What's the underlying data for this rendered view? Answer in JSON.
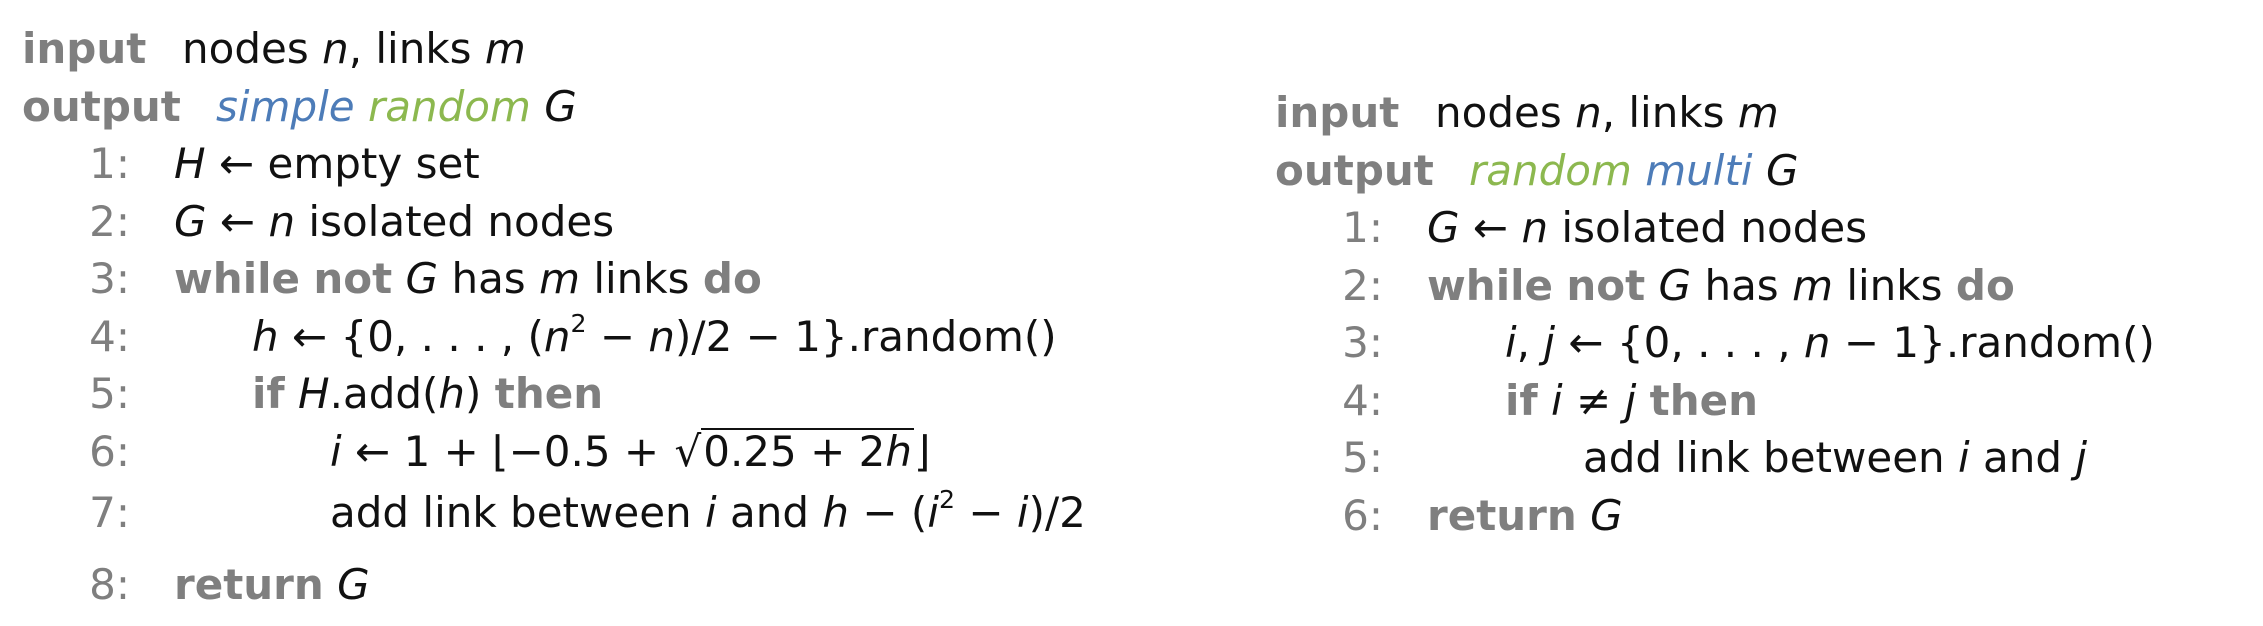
{
  "left": {
    "input_kw": "input",
    "input_text": "nodes",
    "input_n": "n",
    "input_links": ", links",
    "input_m": "m",
    "output_kw": "output",
    "output_simple": "simple",
    "output_random": "random",
    "output_G": "G",
    "lines": [
      {
        "no": "1:"
      },
      {
        "no": "2:"
      },
      {
        "no": "3:"
      },
      {
        "no": "4:"
      },
      {
        "no": "5:"
      },
      {
        "no": "6:"
      },
      {
        "no": "7:"
      },
      {
        "no": "8:"
      }
    ],
    "l1": {
      "H": "H",
      "arrow": " ← ",
      "rest": "empty set"
    },
    "l2": {
      "G": "G",
      "arrow": " ← ",
      "n": "n",
      "rest": " isolated nodes"
    },
    "l3": {
      "while": "while",
      "not": "not",
      "G": "G",
      "has": "has",
      "m": "m",
      "links": "links",
      "do": "do"
    },
    "l4": {
      "h": "h",
      "arrow": " ← {0, . . . , (",
      "n": "n",
      "sq": "2",
      "minus": " − ",
      "n2": "n",
      "tail": ")/2 − 1}.random()"
    },
    "l5": {
      "if": "if",
      "H": "H",
      "add": ".add(",
      "h": "h",
      "close": ")",
      "then": "then"
    },
    "l6": {
      "i": "i",
      "arrow": " ← 1 + ⌊−0.5 + ",
      "sqrt_sym": "√",
      "sqrt_arg": "0.25 + 2",
      "h": "h",
      "floor_close": "⌋"
    },
    "l7": {
      "text": "add link between ",
      "i": "i",
      "and": " and ",
      "h": "h",
      "minus": " − (",
      "i2": "i",
      "sq": "2",
      "minus2": " − ",
      "i3": "i",
      "tail": ")/2"
    },
    "l8": {
      "return": "return",
      "G": "G"
    }
  },
  "right": {
    "input_kw": "input",
    "input_text": "nodes",
    "input_n": "n",
    "input_links": ", links",
    "input_m": "m",
    "output_kw": "output",
    "output_random": "random",
    "output_multi": "multi",
    "output_G": "G",
    "lines": [
      {
        "no": "1:"
      },
      {
        "no": "2:"
      },
      {
        "no": "3:"
      },
      {
        "no": "4:"
      },
      {
        "no": "5:"
      },
      {
        "no": "6:"
      }
    ],
    "l1": {
      "G": "G",
      "arrow": " ← ",
      "n": "n",
      "rest": " isolated nodes"
    },
    "l2": {
      "while": "while",
      "not": "not",
      "G": "G",
      "has": "has",
      "m": "m",
      "links": "links",
      "do": "do"
    },
    "l3": {
      "i": "i",
      "comma": ", ",
      "j": "j",
      "arrow": " ← {0, . . . , ",
      "n": "n",
      "tail": " − 1}.random()"
    },
    "l4": {
      "if": "if",
      "i": "i",
      "neq": " ≠ ",
      "j": "j",
      "then": "then"
    },
    "l5": {
      "text": "add link between ",
      "i": "i",
      "and": " and ",
      "j": "j"
    },
    "l6": {
      "return": "return",
      "G": "G"
    }
  }
}
